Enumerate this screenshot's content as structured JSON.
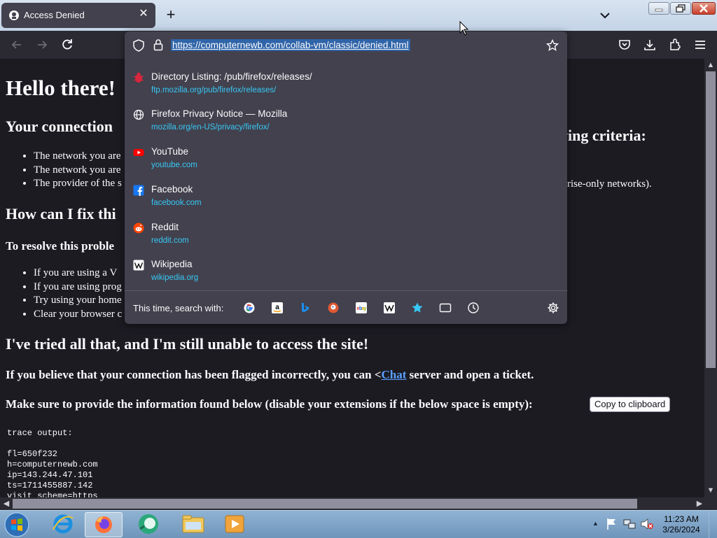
{
  "browser": {
    "tab_title": "Access Denied",
    "url": "https://computernewb.com/collab-vm/classic/denied.html"
  },
  "page": {
    "h1": "Hello there!",
    "p1_left": "Your connection",
    "p1_right": "ving criteria:",
    "criteria": [
      "The network you are",
      "The network you are",
      "The provider of the s"
    ],
    "criteria_right": "rise-only networks).",
    "h_fix": "How can I fix thi",
    "resolve": "To resolve this proble",
    "fixes": [
      "If you are using a V",
      "If you are using prog",
      "Try using your home",
      "Clear your browser c"
    ],
    "h_tried": "I've tried all that, and I'm still unable to access the site!",
    "flagged_before": "If you believe that your connection has been flagged incorrectly, you can <",
    "flagged_link": "Chat",
    "flagged_after": " server and open a ticket.",
    "provide": "Make sure to provide the information found below (disable your extensions if the below space is empty):",
    "copy_button": "Copy to clipboard",
    "trace": "trace output:\n\nfl=650f232\nh=computernewb.com\nip=143.244.47.101\nts=1711455887.142\nvisit_scheme=https"
  },
  "urlbar": {
    "suggestions": [
      {
        "title": "Directory Listing: /pub/firefox/releases/",
        "url": "ftp.mozilla.org/pub/firefox/releases/",
        "icon": "bug-icon"
      },
      {
        "title": "Firefox Privacy Notice — Mozilla",
        "url": "mozilla.org/en-US/privacy/firefox/",
        "icon": "globe-icon"
      },
      {
        "title": "YouTube",
        "url": "youtube.com",
        "icon": "youtube-icon"
      },
      {
        "title": "Facebook",
        "url": "facebook.com",
        "icon": "facebook-icon"
      },
      {
        "title": "Reddit",
        "url": "reddit.com",
        "icon": "reddit-icon"
      },
      {
        "title": "Wikipedia",
        "url": "wikipedia.org",
        "icon": "wikipedia-icon"
      }
    ],
    "search_label": "This time, search with:",
    "engines": [
      "google-icon",
      "amazon-icon",
      "bing-icon",
      "duckduckgo-icon",
      "ebay-icon",
      "wikipedia-icon",
      "bookmarks-icon",
      "tabs-icon",
      "history-icon"
    ]
  },
  "taskbar": {
    "time": "11:23 AM",
    "date": "3/26/2024"
  },
  "colors": {
    "accent": "#38c8f6",
    "page_bg": "#1c1b22",
    "panel_bg": "#42414d",
    "link": "#5aa0ff"
  }
}
